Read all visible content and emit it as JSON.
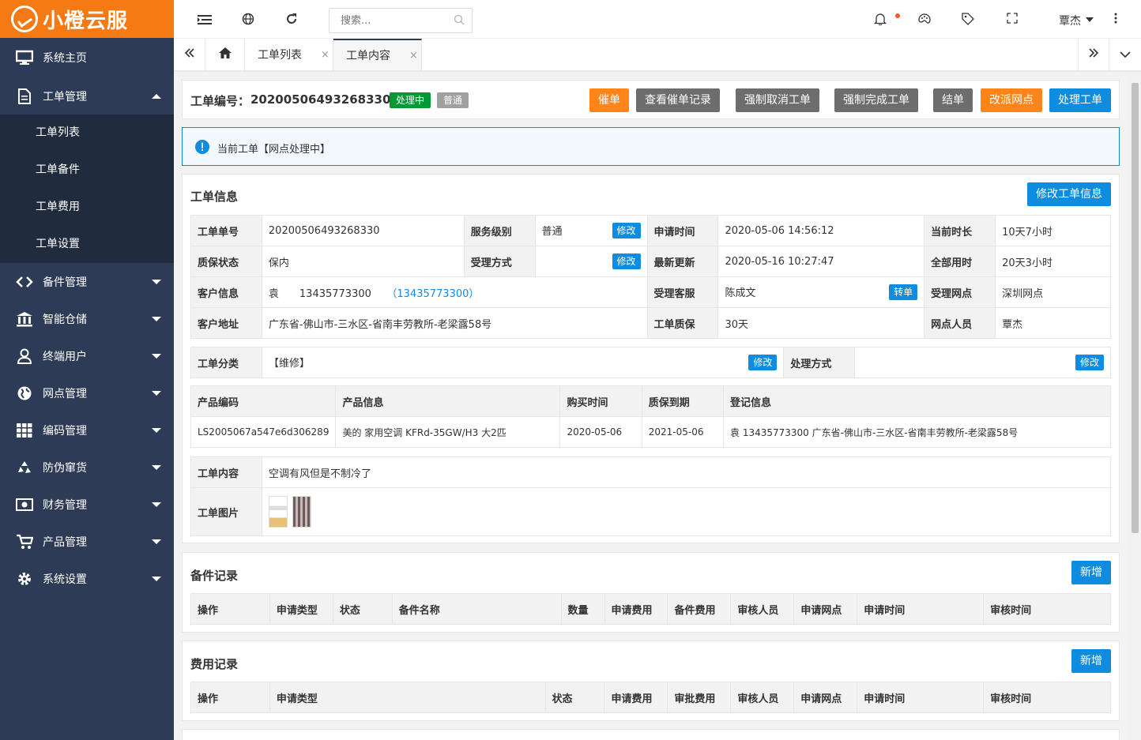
{
  "app": {
    "brand": "小橙云服",
    "user": "覃杰"
  },
  "colors": {
    "accent": "#f57a14",
    "sidebar": "#2e3b56",
    "primary": "#0e8de0"
  },
  "sidebar": {
    "items": [
      {
        "label": "系统主页",
        "icon": "monitor-icon"
      },
      {
        "label": "工单管理",
        "icon": "document-icon",
        "expanded": true,
        "children": [
          "工单列表",
          "工单备件",
          "工单费用",
          "工单设置"
        ]
      },
      {
        "label": "备件管理",
        "icon": "diamond-link-icon"
      },
      {
        "label": "智能仓储",
        "icon": "bank-icon"
      },
      {
        "label": "终端用户",
        "icon": "user-icon"
      },
      {
        "label": "网点管理",
        "icon": "globe-icon"
      },
      {
        "label": "编码管理",
        "icon": "grid-icon"
      },
      {
        "label": "防伪窜货",
        "icon": "recycle-icon"
      },
      {
        "label": "财务管理",
        "icon": "money-icon"
      },
      {
        "label": "产品管理",
        "icon": "cart-icon"
      },
      {
        "label": "系统设置",
        "icon": "gear-icon"
      }
    ]
  },
  "search": {
    "placeholder": "搜索..."
  },
  "tabs": [
    {
      "label": "工单列表",
      "close": "×"
    },
    {
      "label": "工单内容",
      "close": "×",
      "active": true
    }
  ],
  "order": {
    "no_label": "工单编号：",
    "no": "20200506493268330",
    "status": "处理中",
    "level_badge": "普通",
    "buttons": [
      "催单",
      "查看催单记录",
      "强制取消工单",
      "强制完成工单",
      "结单",
      "改派网点",
      "处理工单"
    ]
  },
  "alert": {
    "text": "当前工单【网点处理中】"
  },
  "info": {
    "title": "工单信息",
    "edit_button": "修改工单信息",
    "mod": "修改",
    "transfer": "转单",
    "rows": [
      {
        "l1": "工单单号",
        "v1": "20200506493268330",
        "l2": "服务级别",
        "v2": "普通",
        "l3": "申请时间",
        "v3": "2020-05-06 14:56:12",
        "l4": "当前时长",
        "v4": "10天7小时"
      },
      {
        "l1": "质保状态",
        "v1": "保内",
        "l2": "受理方式",
        "v2": "",
        "l3": "最新更新",
        "v3": "2020-05-16 10:27:47",
        "l4": "全部用时",
        "v4": "20天3小时"
      },
      {
        "l1": "客户信息",
        "v1": "袁　　13435773300",
        "link": "（13435773300）",
        "l3": "受理客服",
        "v3": "陈成文",
        "l4": "受理网点",
        "v4": "深圳网点"
      },
      {
        "l1": "客户地址",
        "v1": "广东省-佛山市-三水区-省南丰劳教所-老梁露58号",
        "l3": "工单质保",
        "v3": "30天",
        "l4": "网点人员",
        "v4": "覃杰"
      }
    ],
    "category_label": "工单分类",
    "category": "【维修】",
    "method_label": "处理方式",
    "product_headers": [
      "产品编码",
      "产品信息",
      "购买时间",
      "质保到期",
      "登记信息"
    ],
    "product": [
      "LS2005067a547e6d306289",
      "美的 家用空调 KFRd-35GW/H3 大2匹",
      "2020-05-06",
      "2021-05-06",
      "袁 13435773300 广东省-佛山市-三水区-省南丰劳教所-老梁露58号"
    ],
    "content_label": "工单内容",
    "content": "空调有风但是不制冷了",
    "image_label": "工单图片"
  },
  "parts": {
    "title": "备件记录",
    "add": "新增",
    "headers": [
      "操作",
      "申请类型",
      "状态",
      "备件名称",
      "数量",
      "申请费用",
      "备件费用",
      "审核人员",
      "申请网点",
      "申请时间",
      "审核时间"
    ]
  },
  "fees": {
    "title": "费用记录",
    "add": "新增",
    "headers": [
      "操作",
      "申请类型",
      "状态",
      "申请费用",
      "审批费用",
      "审核人员",
      "申请网点",
      "申请时间",
      "审核时间"
    ]
  }
}
